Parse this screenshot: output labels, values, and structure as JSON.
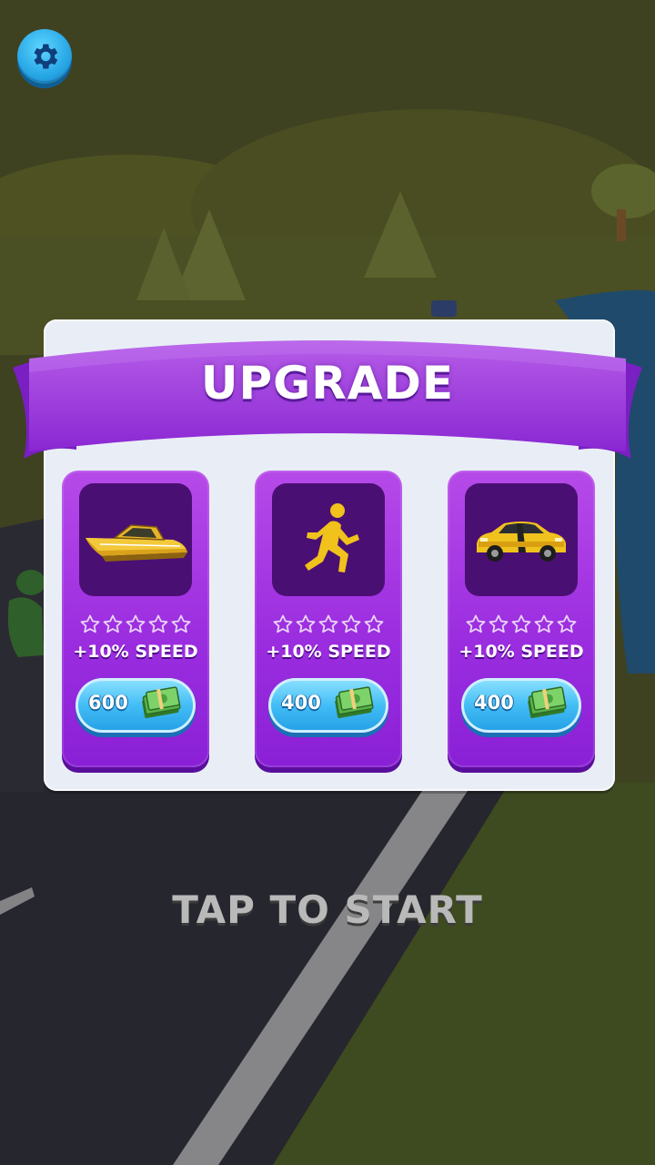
{
  "hud": {
    "settings_icon": "gear-icon"
  },
  "upgrade": {
    "title": "UPGRADE",
    "cards": [
      {
        "item": "speedboat",
        "icon": "speedboat-icon",
        "stars_filled": 0,
        "stars_total": 5,
        "effect": "+10% SPEED",
        "price": "600",
        "currency_icon": "cash-stack-icon"
      },
      {
        "item": "runner",
        "icon": "running-man-icon",
        "stars_filled": 0,
        "stars_total": 5,
        "effect": "+10% SPEED",
        "price": "400",
        "currency_icon": "cash-stack-icon"
      },
      {
        "item": "sports-car",
        "icon": "sports-car-icon",
        "stars_filled": 0,
        "stars_total": 5,
        "effect": "+10% SPEED",
        "price": "400",
        "currency_icon": "cash-stack-icon"
      }
    ]
  },
  "prompt": "TAP TO START",
  "colors": {
    "panel_purple": "#9c2ee0",
    "icon_box": "#4a0f73",
    "price_blue": "#43bdf5",
    "gold": "#f1c21b"
  }
}
